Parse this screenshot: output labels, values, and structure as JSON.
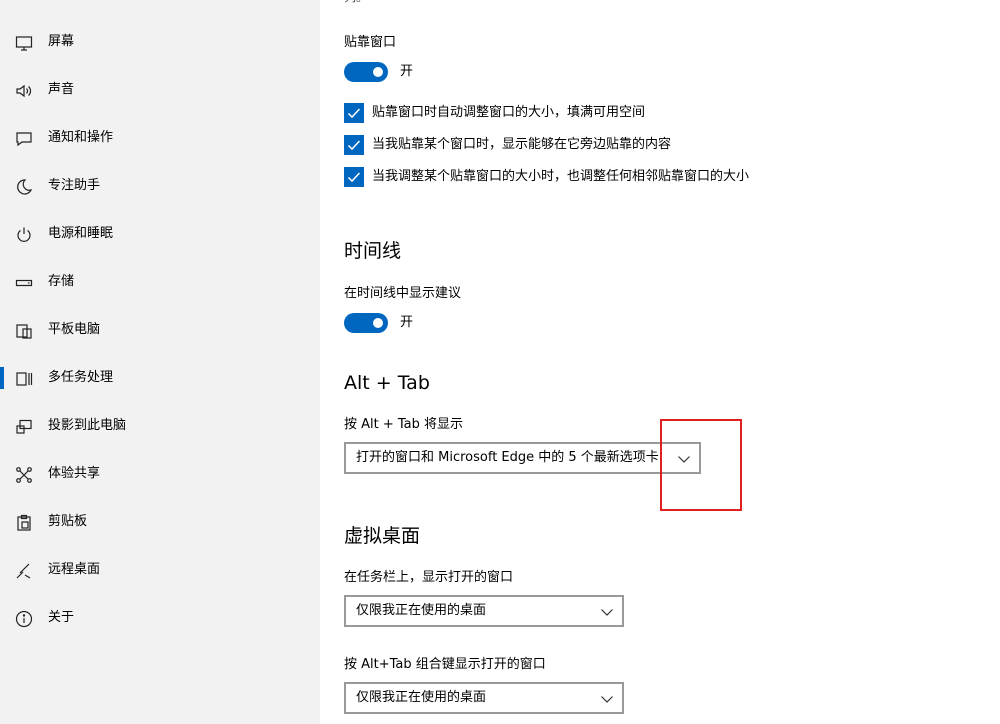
{
  "sidebar": {
    "items": [
      {
        "label": "屏幕",
        "icon": "monitor-icon"
      },
      {
        "label": "声音",
        "icon": "speaker-icon"
      },
      {
        "label": "通知和操作",
        "icon": "notification-icon"
      },
      {
        "label": "专注助手",
        "icon": "moon-icon"
      },
      {
        "label": "电源和睡眠",
        "icon": "power-icon"
      },
      {
        "label": "存储",
        "icon": "storage-icon"
      },
      {
        "label": "平板电脑",
        "icon": "tablet-icon"
      },
      {
        "label": "多任务处理",
        "icon": "multitasking-icon",
        "active": true
      },
      {
        "label": "投影到此电脑",
        "icon": "projector-icon"
      },
      {
        "label": "体验共享",
        "icon": "share-icon"
      },
      {
        "label": "剪贴板",
        "icon": "clipboard-icon"
      },
      {
        "label": "远程桌面",
        "icon": "remote-desktop-icon"
      },
      {
        "label": "关于",
        "icon": "info-icon"
      }
    ]
  },
  "content": {
    "top_fragment": "列。",
    "snap": {
      "label": "贴靠窗口",
      "toggle_text": "开",
      "toggle_on": true,
      "options": [
        {
          "label": "贴靠窗口时自动调整窗口的大小，填满可用空间",
          "checked": true
        },
        {
          "label": "当我贴靠某个窗口时，显示能够在它旁边贴靠的内容",
          "checked": true
        },
        {
          "label": "当我调整某个贴靠窗口的大小时，也调整任何相邻贴靠窗口的大小",
          "checked": true
        }
      ]
    },
    "timeline": {
      "title": "时间线",
      "label": "在时间线中显示建议",
      "toggle_text": "开",
      "toggle_on": true
    },
    "alt_tab": {
      "title": "Alt + Tab",
      "label": "按 Alt + Tab 将显示",
      "selected": "打开的窗口和 Microsoft Edge 中的 5 个最新选项卡"
    },
    "virtual_desktops": {
      "title": "虚拟桌面",
      "taskbar_label": "在任务栏上，显示打开的窗口",
      "taskbar_selected": "仅限我正在使用的桌面",
      "alt_tab_label": "按 Alt+Tab 组合键显示打开的窗口",
      "alt_tab_selected": "仅限我正在使用的桌面"
    }
  },
  "colors": {
    "accent": "#0067c0",
    "sidebar_bg": "#f2f2f2",
    "annotation": "#e02020"
  }
}
